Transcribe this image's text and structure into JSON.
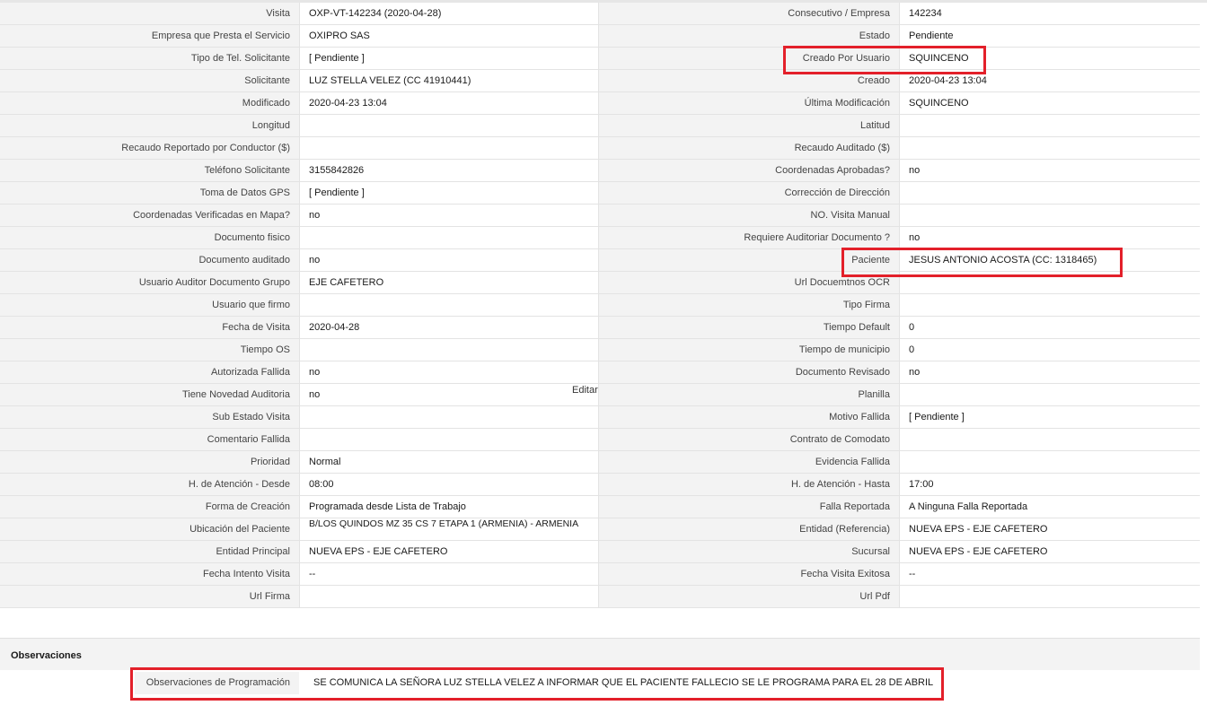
{
  "rows": [
    {
      "l1": "Visita",
      "v1": "OXP-VT-142234 (2020-04-28)",
      "l2": "Consecutivo / Empresa",
      "v2": "142234"
    },
    {
      "l1": "Empresa que Presta el Servicio",
      "v1": "OXIPRO SAS",
      "l2": "Estado",
      "v2": "Pendiente"
    },
    {
      "l1": "Tipo de Tel. Solicitante",
      "v1": "[ Pendiente ]",
      "l2": "Creado Por Usuario",
      "v2": "SQUINCENO"
    },
    {
      "l1": "Solicitante",
      "v1": "LUZ STELLA VELEZ (CC 41910441)",
      "l2": "Creado",
      "v2": "2020-04-23 13:04"
    },
    {
      "l1": "Modificado",
      "v1": "2020-04-23 13:04",
      "l2": "Última Modificación",
      "v2": " SQUINCENO"
    },
    {
      "l1": "Longitud",
      "v1": "",
      "l2": "Latitud",
      "v2": ""
    },
    {
      "l1": "Recaudo Reportado por Conductor ($)",
      "v1": "",
      "l2": "Recaudo Auditado ($)",
      "v2": ""
    },
    {
      "l1": "Teléfono Solicitante",
      "v1": "3155842826",
      "l2": "Coordenadas Aprobadas?",
      "v2": " no"
    },
    {
      "l1": "Toma de Datos GPS",
      "v1": "[ Pendiente ]",
      "l2": "Corrección de Dirección",
      "v2": ""
    },
    {
      "l1": "Coordenadas Verificadas en Mapa?",
      "v1": " no",
      "l2": "NO. Visita Manual",
      "v2": ""
    },
    {
      "l1": "Documento fisico",
      "v1": "",
      "l2": "Requiere Auditoriar Documento ?",
      "v2": " no"
    },
    {
      "l1": "Documento auditado",
      "v1": " no",
      "l2": "Paciente",
      "v2": "JESUS ANTONIO ACOSTA (CC: 1318465)"
    },
    {
      "l1": "Usuario Auditor Documento Grupo",
      "v1": "EJE CAFETERO",
      "l2": "Url Docuemtnos OCR",
      "v2": ""
    },
    {
      "l1": "Usuario que firmo",
      "v1": "",
      "l2": "Tipo Firma",
      "v2": ""
    },
    {
      "l1": "Fecha de Visita",
      "v1": " 2020-04-28",
      "l2": "Tiempo Default",
      "v2": "0"
    },
    {
      "l1": "Tiempo OS",
      "v1": "",
      "l2": "Tiempo de municipio",
      "v2": "0"
    },
    {
      "l1": "Autorizada Fallida",
      "v1": " no",
      "l2": "Documento Revisado",
      "v2": " no"
    },
    {
      "l1": "Tiene Novedad Auditoria",
      "v1": " no",
      "l2": "Planilla",
      "v2": ""
    },
    {
      "l1": "Sub Estado Visita",
      "v1": "",
      "l2": "Motivo Fallida",
      "v2": "[ Pendiente ]"
    },
    {
      "l1": "Comentario Fallida",
      "v1": "",
      "l2": "Contrato de Comodato",
      "v2": ""
    },
    {
      "l1": "Prioridad",
      "v1": "Normal",
      "l2": "Evidencia Fallida",
      "v2": ""
    },
    {
      "l1": "H. de Atención - Desde",
      "v1": "08:00",
      "l2": "H. de Atención - Hasta",
      "v2": "17:00"
    },
    {
      "l1": "Forma de Creación",
      "v1": "Programada desde Lista de Trabajo",
      "l2": "Falla Reportada",
      "v2": "A Ninguna Falla Reportada"
    },
    {
      "l1": "Ubicación del Paciente",
      "v1": "B/LOS QUINDOS MZ 35 CS 7 ETAPA 1 (ARMENIA) - ARMENIA",
      "l2": "Entidad (Referencia)",
      "v2": "NUEVA EPS - EJE CAFETERO"
    },
    {
      "l1": "Entidad Principal",
      "v1": "NUEVA EPS - EJE CAFETERO",
      "l2": "Sucursal",
      "v2": "NUEVA EPS - EJE CAFETERO"
    },
    {
      "l1": "Fecha Intento Visita",
      "v1": " --",
      "l2": "Fecha Visita Exitosa",
      "v2": " --"
    },
    {
      "l1": "Url Firma",
      "v1": "",
      "l2": "Url Pdf",
      "v2": ""
    }
  ],
  "edit_link": "Editar",
  "observaciones": {
    "section_title": "Observaciones",
    "label": "Observaciones de Programación",
    "value": "SE COMUNICA LA SEÑORA LUZ STELLA VELEZ A INFORMAR QUE EL PACIENTE FALLECIO SE LE PROGRAMA PARA EL 28 DE ABRIL"
  },
  "highlight_color": "#e3202a"
}
